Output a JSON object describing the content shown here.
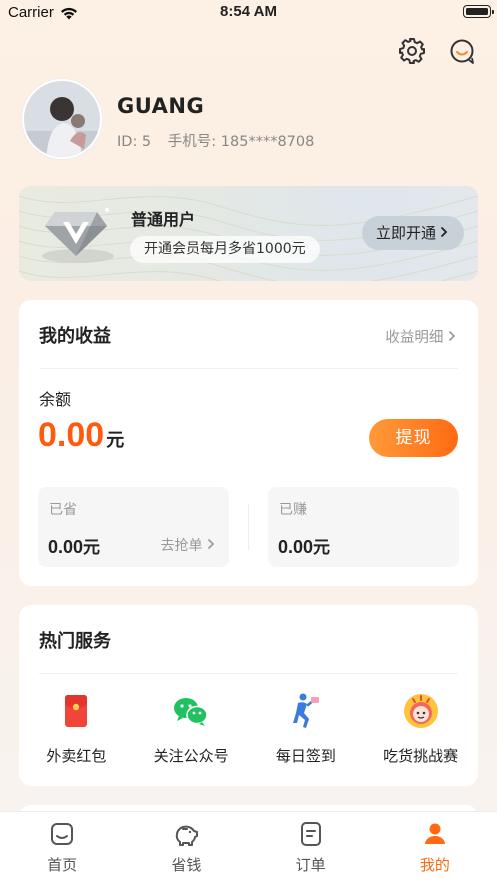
{
  "status_bar": {
    "carrier": "Carrier",
    "time": "8:54 AM"
  },
  "header_icons": [
    "settings-icon",
    "customer-service-icon"
  ],
  "profile": {
    "name": "GUANG",
    "id_text": "ID: 5",
    "phone_text": "手机号: 185****8708"
  },
  "vip": {
    "title": "普通用户",
    "subtitle": "开通会员每月多省1000元",
    "button": "立即开通"
  },
  "earnings": {
    "title": "我的收益",
    "detail_link": "收益明细",
    "balance_label": "余额",
    "balance_value": "0.00",
    "balance_unit": "元",
    "withdraw": "提现",
    "saved": {
      "label": "已省",
      "value": "0.00",
      "unit": "元",
      "link": "去抢单"
    },
    "earned": {
      "label": "已赚",
      "value": "0.00",
      "unit": "元"
    }
  },
  "services": {
    "title": "热门服务",
    "items": [
      {
        "label": "外卖红包",
        "icon": "red-envelope-icon"
      },
      {
        "label": "关注公众号",
        "icon": "wechat-icon"
      },
      {
        "label": "每日签到",
        "icon": "checkin-icon"
      },
      {
        "label": "吃货挑战赛",
        "icon": "foodie-challenge-icon"
      }
    ]
  },
  "tab_bar": {
    "active_color": "#ff6a12",
    "tabs": [
      {
        "label": "首页",
        "icon": "home-icon"
      },
      {
        "label": "省钱",
        "icon": "piggy-bank-icon"
      },
      {
        "label": "订单",
        "icon": "order-icon"
      },
      {
        "label": "我的",
        "icon": "profile-icon",
        "active": true
      }
    ]
  }
}
